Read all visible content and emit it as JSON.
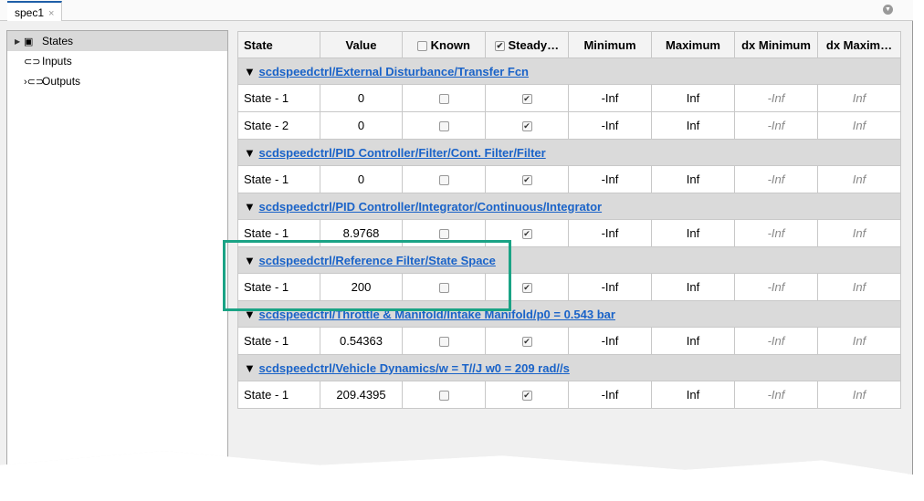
{
  "tab": {
    "label": "spec1",
    "close": "×"
  },
  "tree": [
    {
      "label": "States",
      "icon": "states-icon"
    },
    {
      "label": "Inputs",
      "icon": "inport-icon"
    },
    {
      "label": "Outputs",
      "icon": "outport-icon"
    }
  ],
  "columns": [
    "State",
    "Value",
    "Known",
    "Steady…",
    "Minimum",
    "Maximum",
    "dx Minimum",
    "dx Maxim…"
  ],
  "groups": [
    {
      "path": "scdspeedctrl/External Disturbance/Transfer Fcn",
      "rows": [
        {
          "state": "State - 1",
          "value": "0",
          "known": false,
          "steady": true,
          "min": "-Inf",
          "max": "Inf",
          "dxmin": "-Inf",
          "dxmax": "Inf"
        },
        {
          "state": "State - 2",
          "value": "0",
          "known": false,
          "steady": true,
          "min": "-Inf",
          "max": "Inf",
          "dxmin": "-Inf",
          "dxmax": "Inf"
        }
      ]
    },
    {
      "path": "scdspeedctrl/PID Controller/Filter/Cont. Filter/Filter",
      "rows": [
        {
          "state": "State - 1",
          "value": "0",
          "known": false,
          "steady": true,
          "min": "-Inf",
          "max": "Inf",
          "dxmin": "-Inf",
          "dxmax": "Inf"
        }
      ]
    },
    {
      "path": "scdspeedctrl/PID Controller/Integrator/Continuous/Integrator",
      "rows": [
        {
          "state": "State - 1",
          "value": "8.9768",
          "known": false,
          "steady": true,
          "min": "-Inf",
          "max": "Inf",
          "dxmin": "-Inf",
          "dxmax": "Inf"
        }
      ]
    },
    {
      "path": "scdspeedctrl/Reference Filter/State Space",
      "rows": [
        {
          "state": "State - 1",
          "value": "200",
          "known": false,
          "steady": true,
          "min": "-Inf",
          "max": "Inf",
          "dxmin": "-Inf",
          "dxmax": "Inf"
        }
      ]
    },
    {
      "path": "scdspeedctrl/Throttle & Manifold/Intake Manifold/p0 = 0.543 bar",
      "rows": [
        {
          "state": "State - 1",
          "value": "0.54363",
          "known": false,
          "steady": true,
          "min": "-Inf",
          "max": "Inf",
          "dxmin": "-Inf",
          "dxmax": "Inf"
        }
      ]
    },
    {
      "path": "scdspeedctrl/Vehicle Dynamics/w = T//J w0 = 209 rad//s",
      "rows": [
        {
          "state": "State - 1",
          "value": "209.4395",
          "known": false,
          "steady": true,
          "min": "-Inf",
          "max": "Inf",
          "dxmin": "-Inf",
          "dxmax": "Inf"
        }
      ]
    }
  ],
  "highlight_color": "#1aa385"
}
